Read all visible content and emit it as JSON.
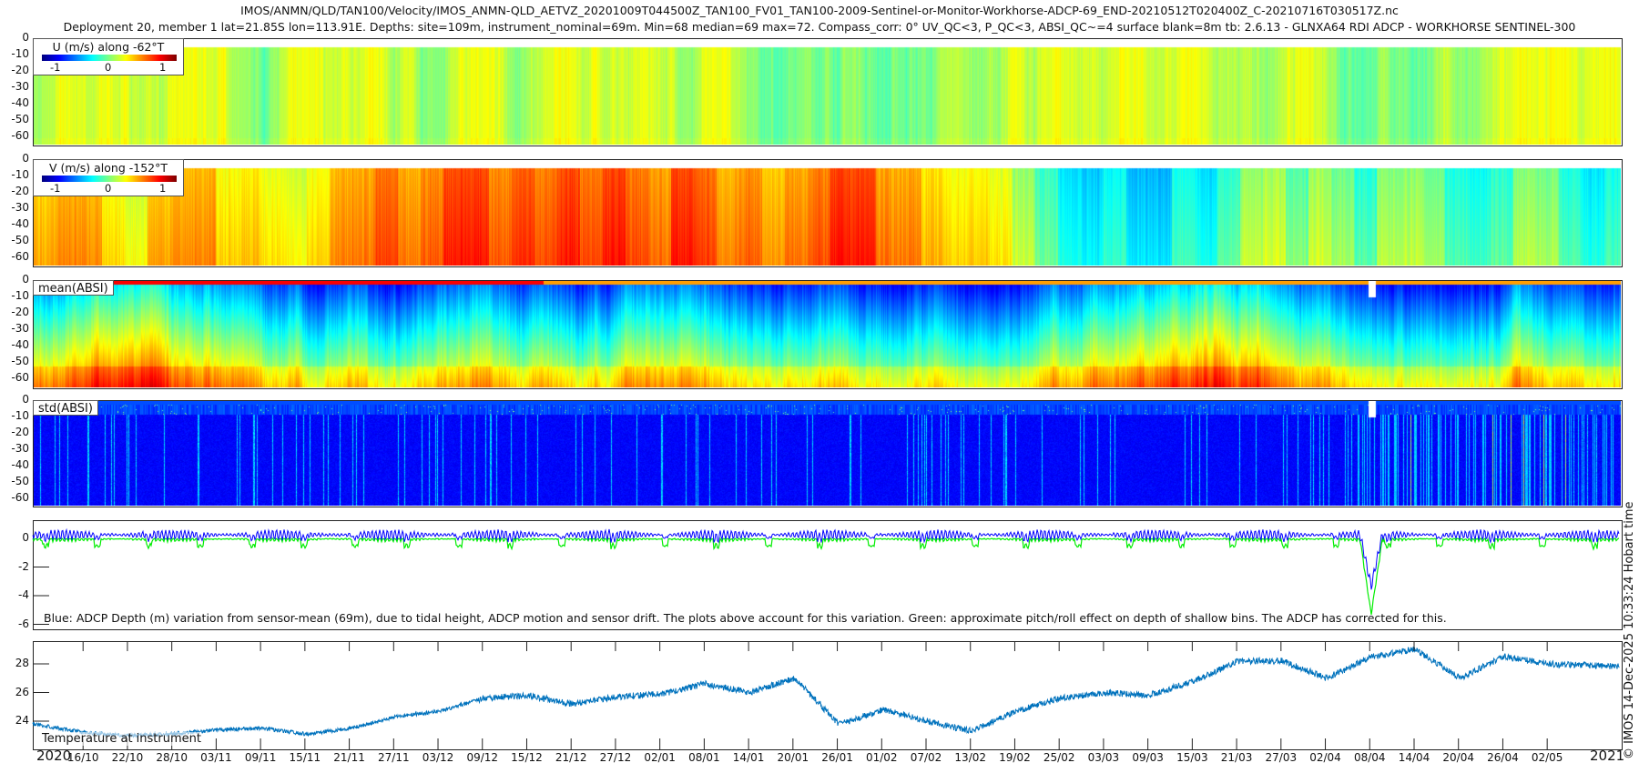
{
  "titles": {
    "line1": "IMOS/ANMN/QLD/TAN100/Velocity/IMOS_ANMN-QLD_AETVZ_20201009T044500Z_TAN100_FV01_TAN100-2009-Sentinel-or-Monitor-Workhorse-ADCP-69_END-20210512T020400Z_C-20210716T030517Z.nc",
    "line2": "Deployment 20, member 1 lat=21.85S lon=113.91E. Depths: site=109m, instrument_nominal=69m. Min=68 median=69 max=72. Compass_corr: 0° UV_QC<3, P_QC<3, ABSI_QC~=4 surface blank=8m tb: 2.6.13 - GLNXA64 RDI ADCP - WORKHORSE SENTINEL-300"
  },
  "footer": "© IMOS 14-Dec-2025 10:33:24 Hobart time",
  "chart_data": [
    {
      "type": "heatmap",
      "name": "u",
      "title": "U (m/s) along -62°T",
      "colorbar_ticks": [
        "-1",
        "0",
        "1"
      ],
      "clim": [
        -1.25,
        1.25
      ],
      "ylabels": [
        "0",
        "-10",
        "-20",
        "-30",
        "-40",
        "-50",
        "-60"
      ],
      "typical_value_range": [
        -0.1,
        0.3
      ]
    },
    {
      "type": "heatmap",
      "name": "v",
      "title": "V (m/s) along -152°T",
      "colorbar_ticks": [
        "-1",
        "0",
        "1"
      ],
      "clim": [
        -1.25,
        1.25
      ],
      "ylabels": [
        "0",
        "-10",
        "-20",
        "-30",
        "-40",
        "-50",
        "-60"
      ],
      "typical_value_range": [
        -0.5,
        0.7
      ]
    },
    {
      "type": "heatmap",
      "name": "mean_absi",
      "title": "mean(ABSI)",
      "ylabels": [
        "0",
        "-10",
        "-20",
        "-30",
        "-40",
        "-50",
        "-60"
      ]
    },
    {
      "type": "heatmap",
      "name": "std_absi",
      "title": "std(ABSI)",
      "ylabels": [
        "0",
        "-10",
        "-20",
        "-30",
        "-40",
        "-50",
        "-60"
      ]
    },
    {
      "type": "line",
      "name": "depth",
      "annotation": "Blue: ADCP Depth (m) variation from sensor-mean (69m), due to tidal height, ADCP motion and sensor drift. The plots above account for this variation. Green: approximate pitch/roll effect on depth of shallow bins. The ADCP has corrected for this.",
      "ylabels": [
        "0",
        "-2",
        "-4",
        "-6"
      ],
      "ylim": [
        -1.3,
        6.2
      ],
      "series": [
        {
          "name": "ADCP depth variation",
          "color": "#0000ff",
          "tidal_amplitude_m": 0.5,
          "spike": {
            "date": "08/04",
            "value": 4.0
          }
        },
        {
          "name": "pitch/roll effect",
          "color": "#00ee00",
          "spike": {
            "date": "08/04",
            "value": 5.4
          }
        }
      ]
    },
    {
      "type": "line",
      "name": "temperature",
      "label": "Temperature at instrument",
      "color": "#0072bd",
      "ylabels": [
        "24",
        "26",
        "28"
      ],
      "ylim": [
        22.1,
        29.6
      ],
      "x_days": [
        0,
        7,
        13,
        19,
        25,
        31,
        37,
        43,
        49,
        55,
        61,
        67,
        73,
        79,
        85,
        91,
        97,
        103,
        109,
        115,
        121,
        127,
        133,
        139,
        145,
        151,
        157,
        163,
        169,
        175,
        181,
        187,
        193,
        199,
        205,
        215
      ],
      "values": [
        23.8,
        23.2,
        23.0,
        23.1,
        23.4,
        23.5,
        23.1,
        23.5,
        24.3,
        24.7,
        25.6,
        25.8,
        25.2,
        25.7,
        25.9,
        26.6,
        26.0,
        27.0,
        23.8,
        24.8,
        24.0,
        23.3,
        24.7,
        25.6,
        26.0,
        25.8,
        26.8,
        28.2,
        28.2,
        27.0,
        28.5,
        29.0,
        27.0,
        28.5,
        28.0,
        27.8
      ]
    }
  ],
  "xaxis": {
    "year_start": "2020",
    "year_end": "2021",
    "start_date": "09/10",
    "first_tick_day": 6.8,
    "tick_step_days": 6,
    "ticks": [
      "16/10",
      "22/10",
      "28/10",
      "03/11",
      "09/11",
      "15/11",
      "21/11",
      "27/11",
      "03/12",
      "09/12",
      "15/12",
      "21/12",
      "27/12",
      "02/01",
      "08/01",
      "14/01",
      "20/01",
      "26/01",
      "01/02",
      "07/02",
      "13/02",
      "19/02",
      "25/02",
      "03/03",
      "09/03",
      "15/03",
      "21/03",
      "27/03",
      "02/04",
      "08/04",
      "14/04",
      "20/04",
      "26/04",
      "02/05"
    ],
    "total_days": 215
  }
}
